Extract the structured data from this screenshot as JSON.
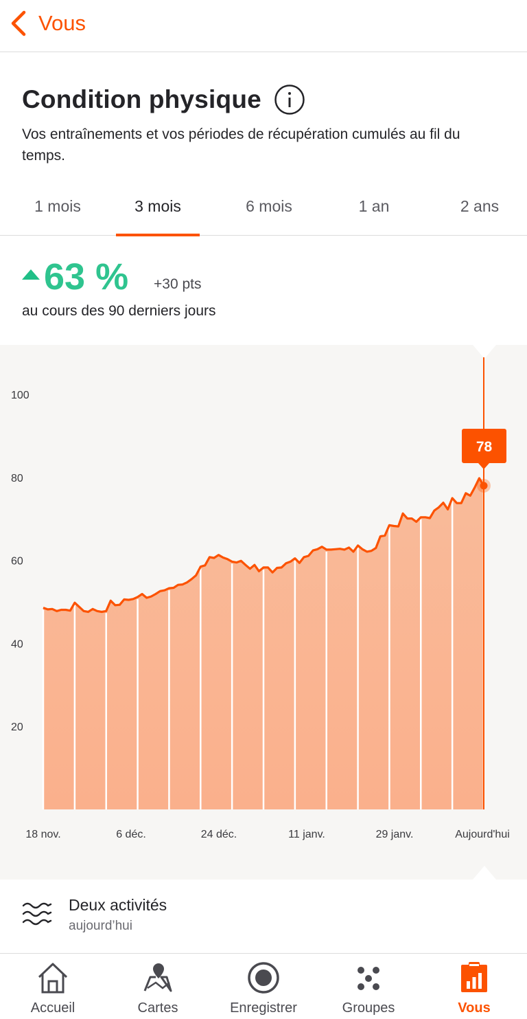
{
  "header": {
    "back_label": "Vous"
  },
  "page": {
    "title": "Condition physique",
    "subtitle": "Vos entraînements et vos périodes de récupération cumulés au fil du temps."
  },
  "tabs": [
    {
      "label": "1 mois",
      "active": false
    },
    {
      "label": "3 mois",
      "active": true
    },
    {
      "label": "6 mois",
      "active": false
    },
    {
      "label": "1 an",
      "active": false
    },
    {
      "label": "2 ans",
      "active": false
    }
  ],
  "summary": {
    "value": "63 %",
    "delta": "+30 pts",
    "period": "au cours des 90 derniers jours"
  },
  "chart_data": {
    "type": "area",
    "series": [
      {
        "values": [
          48.6,
          48.2,
          48.3,
          47.8,
          48.1,
          48.1,
          47.9,
          49.8,
          48.8,
          47.8,
          47.6,
          48.3,
          47.8,
          47.6,
          47.8,
          50.3,
          49.2,
          49.3,
          50.6,
          50.5,
          50.7,
          51.2,
          51.9,
          51.0,
          51.3,
          51.9,
          52.6,
          52.8,
          53.3,
          53.4,
          54.1,
          54.2,
          54.7,
          55.5,
          56.4,
          58.5,
          58.8,
          60.8,
          60.6,
          61.3,
          60.7,
          60.3,
          59.7,
          59.5,
          59.9,
          58.9,
          58.0,
          58.9,
          57.4,
          58.3,
          58.3,
          57.1,
          58.2,
          58.3,
          59.3,
          59.7,
          60.5,
          59.4,
          60.8,
          61.1,
          62.4,
          62.7,
          63.3,
          62.6,
          62.6,
          62.7,
          62.8,
          62.6,
          63.1,
          62.1,
          63.6,
          62.7,
          62.1,
          62.3,
          63.0,
          65.8,
          66.0,
          68.5,
          68.3,
          68.2,
          71.3,
          70.1,
          70.1,
          69.3,
          70.4,
          70.4,
          70.2,
          72.0,
          72.8,
          73.9,
          72.3,
          75.0,
          73.8,
          73.8,
          76.2,
          75.6,
          77.6,
          79.8,
          78.0
        ]
      }
    ],
    "x_tick_labels": [
      "18 nov.",
      "6 déc.",
      "24 déc.",
      "11 janv.",
      "29 janv.",
      "Aujourd'hui"
    ],
    "y_ticks": [
      20,
      40,
      60,
      80,
      100
    ],
    "ylim": [
      0,
      100
    ],
    "grid": false,
    "tooltip": {
      "value": "78"
    },
    "colors": {
      "line": "#fc5200",
      "fill": "#f9b896",
      "tooltip_bg": "#fc5200"
    }
  },
  "activity": {
    "title": "Deux activités",
    "subtitle": "aujourd’hui"
  },
  "nav": [
    {
      "label": "Accueil",
      "icon": "home-icon",
      "active": false
    },
    {
      "label": "Cartes",
      "icon": "map-icon",
      "active": false
    },
    {
      "label": "Enregistrer",
      "icon": "record-icon",
      "active": false
    },
    {
      "label": "Groupes",
      "icon": "groups-icon",
      "active": false
    },
    {
      "label": "Vous",
      "icon": "you-icon",
      "active": true
    }
  ]
}
